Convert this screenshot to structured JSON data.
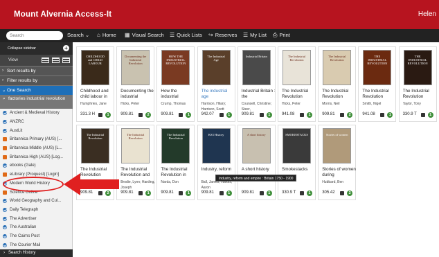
{
  "app": {
    "title": "Mount Alvernia Access-It",
    "user": "Helen"
  },
  "toolbar": {
    "search_placeholder": "Search",
    "search_menu": "Search ⌄",
    "home": "Home",
    "visual_search": "Visual Search",
    "quick_lists": "Quick Lists",
    "reserves": "Reserves",
    "my_list": "My List",
    "print": "Print"
  },
  "sidebar": {
    "collapse_label": "Collapse sidebar",
    "view_label": "View",
    "sort_label": "Sort results by",
    "filter_label": "Filter results by",
    "one_search_label": "One Search",
    "search_term": "factories industrial revolution",
    "items": [
      {
        "label": "Ancient & Medieval History",
        "dot": "blue"
      },
      {
        "label": "ANZRC",
        "dot": "blue"
      },
      {
        "label": "AustLit",
        "dot": "blue"
      },
      {
        "label": "Britannica Primary (AUS) [...",
        "dot": "orange"
      },
      {
        "label": "Britannica Middle (AUS) [L...",
        "dot": "orange"
      },
      {
        "label": "Britannica High (AUS) [Log...",
        "dot": "orange"
      },
      {
        "label": "ebooks (Gale)",
        "dot": "blue"
      },
      {
        "label": "eLibrary (Proquest) [Login]",
        "dot": "orange"
      },
      {
        "label": "Modern World History",
        "dot": "blue"
      },
      {
        "label": "Science Online",
        "dot": "orange"
      },
      {
        "label": "World Geography and Cul...",
        "dot": "blue"
      },
      {
        "label": "Daily Telegraph",
        "dot": "blue"
      },
      {
        "label": "The Advertiser",
        "dot": "blue"
      },
      {
        "label": "The Australian",
        "dot": "blue"
      },
      {
        "label": "The Cairns Post",
        "dot": "blue"
      },
      {
        "label": "The Courier Mail",
        "dot": "blue"
      }
    ],
    "history_label": "Search History"
  },
  "results": [
    {
      "title": "Childhood and child labour in",
      "author": "Humphries, Jane",
      "call": "331.3 H",
      "count": "1",
      "cover": "#3a2a1a",
      "cover_text": "CHILDHOOD and CHILD LABOUR"
    },
    {
      "title": "Documenting the industrial",
      "author": "Hicks, Peter",
      "call": "909.81",
      "count": "2",
      "cover": "#c9c2b0",
      "cover_text": "Documenting the Industrial Revolution"
    },
    {
      "title": "How the industrial",
      "author": "Crump, Thomas",
      "call": "909.81",
      "count": "1",
      "cover": "#7a3a22",
      "cover_text": "HOW THE INDUSTRIAL REVOLUTION"
    },
    {
      "title": "The industrial age",
      "author": "Harrison, Hilary; Harrison, Scott",
      "call": "942.07",
      "count": "1",
      "cover": "#5a3f2a",
      "cover_text": "The Industrial Age",
      "link": true
    },
    {
      "title": "Industrial Britain : the",
      "author": "Counsell, Christine; Steer,",
      "call": "909.81",
      "count": "1",
      "cover": "#4a4a4a",
      "cover_text": "Industrial Britain"
    },
    {
      "title": "The Industrial Revolution",
      "author": "Hicks, Peter",
      "call": "941.08",
      "count": "1",
      "cover": "#e8e3d8",
      "cover_text": "The Industrial Revolution"
    },
    {
      "title": "The Industrial Revolution",
      "author": "Morris, Neil",
      "call": "909.81",
      "count": "2",
      "cover": "#d9cbb0",
      "cover_text": "The Industrial Revolution"
    },
    {
      "title": "The Industrial Revolution",
      "author": "Smith, Nigel",
      "call": "941.08",
      "count": "1",
      "cover": "#6b2a10",
      "cover_text": "THE INDUSTRIAL REVOLUTION"
    },
    {
      "title": "The Industrial Revolution",
      "author": "Taylor, Tony",
      "call": "330.9 T",
      "count": "1",
      "cover": "#2a1a12",
      "cover_text": "THE INDUSTRIAL REVOLUTION"
    },
    {
      "title": "The Industrial Revolution",
      "author": "",
      "call": "909.81",
      "count": "2",
      "cover": "#3a2e22",
      "cover_text": "The Industrial Revolution"
    },
    {
      "title": "The Industrial Revolution and",
      "author": "Brodie, Lynn; Harding, Joseph",
      "call": "909.81",
      "count": "1",
      "cover": "#e9e2d0",
      "cover_text": "The Industrial Revolution"
    },
    {
      "title": "The Industrial Revolution in",
      "author": "Narda, Don",
      "call": "909.81",
      "count": "1",
      "cover": "#233a2a",
      "cover_text": "The Industrial Revolution"
    },
    {
      "title": "Industry, reform",
      "author": "Ball, James; Wilkes, Aaron",
      "call": "909.81",
      "count": "1",
      "cover": "#1f3550",
      "cover_text": "KS3 History"
    },
    {
      "title": "A short history",
      "author": "",
      "call": "909.81",
      "count": "1",
      "cover": "#c8c0b0",
      "cover_text": "A short history"
    },
    {
      "title": "Smokestacks",
      "author": "",
      "call": "330.9 T",
      "count": "1",
      "cover": "#3a3a3a",
      "cover_text": "SMOKESTACKS"
    },
    {
      "title": "Stories of women during",
      "author": "Hubbard, Ben",
      "call": "305.42",
      "count": "2",
      "cover": "#b09a7a",
      "cover_text": "Stories of women"
    }
  ],
  "tooltip": "Industry, reform and empire : Britain 1750 - 1900",
  "colors": {
    "brand": "#b7141f",
    "toolbar": "#222222",
    "accent": "#1e6fb8",
    "badge": "#3f8f3a",
    "annotation": "#e02020"
  }
}
